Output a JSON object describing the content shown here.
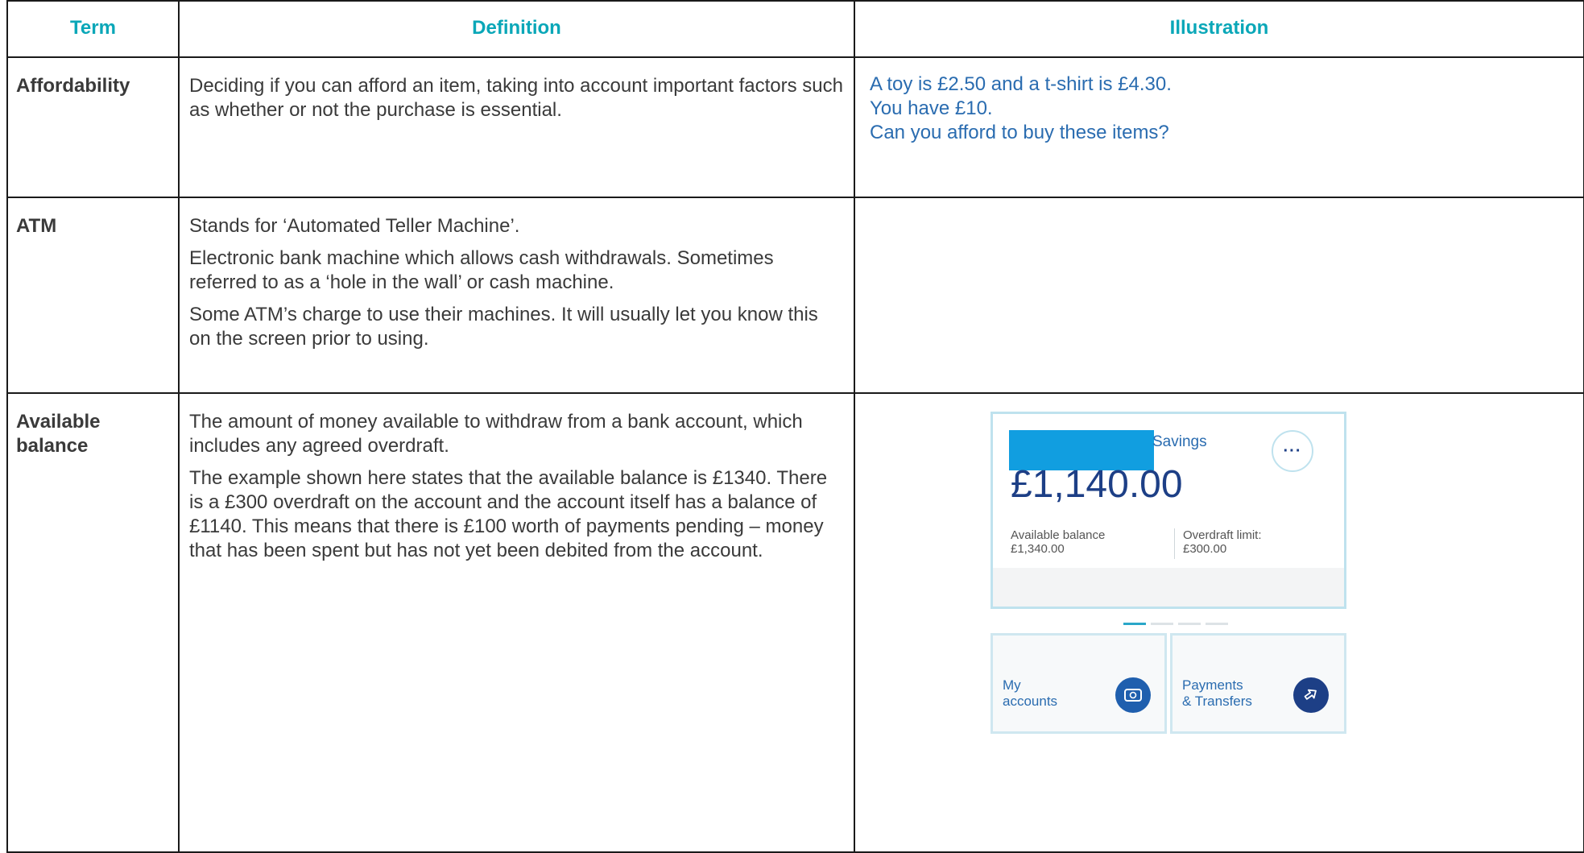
{
  "header": {
    "term": "Term",
    "definition": "Definition",
    "illustration": "Illustration"
  },
  "rows": [
    {
      "term": "Affordability",
      "definition": [
        "Deciding if you can afford an item, taking into account important factors such as whether or not the purchase is essential."
      ],
      "illustration": [
        "A toy is £2.50 and a t-shirt is £4.30.",
        "You have £10.",
        "Can you afford to buy these items?"
      ]
    },
    {
      "term": "ATM",
      "definition": [
        "Stands for ‘Automated Teller Machine’.",
        "Electronic bank machine which allows cash withdrawals. Sometimes  referred to as a ‘hole in the wall’ or cash machine.",
        "Some ATM’s charge to use their machines.  It will usually let you know this on the screen prior to using."
      ]
    },
    {
      "term": "Available balance",
      "definition": [
        "The amount of money available to withdraw from a bank account, which includes any agreed overdraft.",
        "The example shown here states that the available balance is £1340.  There is a £300 overdraft on the account and the account itself has a balance of £1140.  This means that there is £100 worth of payments pending – money that has been spent but has not yet been debited from the account."
      ]
    }
  ],
  "app": {
    "account_name": "Savings",
    "more_label": "···",
    "balance": "£1,140.00",
    "available_label": "Available balance",
    "available_value": "£1,340.00",
    "overdraft_label": "Overdraft limit:",
    "overdraft_value": "£300.00",
    "tile1_label_line1": "My",
    "tile1_label_line2": "accounts",
    "tile2_label_line1": "Payments",
    "tile2_label_line2": "& Transfers",
    "redaction_color": "#119ee0",
    "brand_color": "#1d3f86",
    "accent_color": "#0aa7b8",
    "icons": [
      "more-icon",
      "wallet-icon",
      "transfer-icon"
    ]
  }
}
